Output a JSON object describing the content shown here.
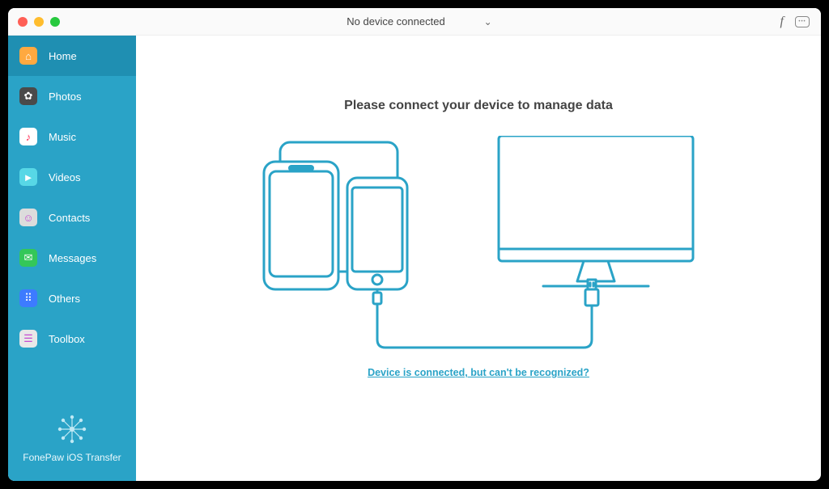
{
  "titlebar": {
    "device_status": "No device connected"
  },
  "sidebar": {
    "items": [
      {
        "label": "Home",
        "icon": "home-icon",
        "icon_bg": "#ffa940",
        "glyph": "⌂"
      },
      {
        "label": "Photos",
        "icon": "photos-icon",
        "icon_bg": "#4a4a4a",
        "glyph": "✿"
      },
      {
        "label": "Music",
        "icon": "music-icon",
        "icon_bg": "#ffffff",
        "glyph": "♪"
      },
      {
        "label": "Videos",
        "icon": "videos-icon",
        "icon_bg": "#57d7e6",
        "glyph": "►"
      },
      {
        "label": "Contacts",
        "icon": "contacts-icon",
        "icon_bg": "#dcdcdc",
        "glyph": "☺"
      },
      {
        "label": "Messages",
        "icon": "messages-icon",
        "icon_bg": "#34c759",
        "glyph": "✉"
      },
      {
        "label": "Others",
        "icon": "others-icon",
        "icon_bg": "#3d7bff",
        "glyph": "⠿"
      },
      {
        "label": "Toolbox",
        "icon": "toolbox-icon",
        "icon_bg": "#e8e8e8",
        "glyph": "☰"
      }
    ],
    "active_index": 0,
    "footer_brand": "FonePaw iOS Transfer"
  },
  "main": {
    "headline": "Please connect your device to manage data",
    "help_link": "Device is connected, but can't be recognized?",
    "illustration_color": "#2aa3c7"
  }
}
